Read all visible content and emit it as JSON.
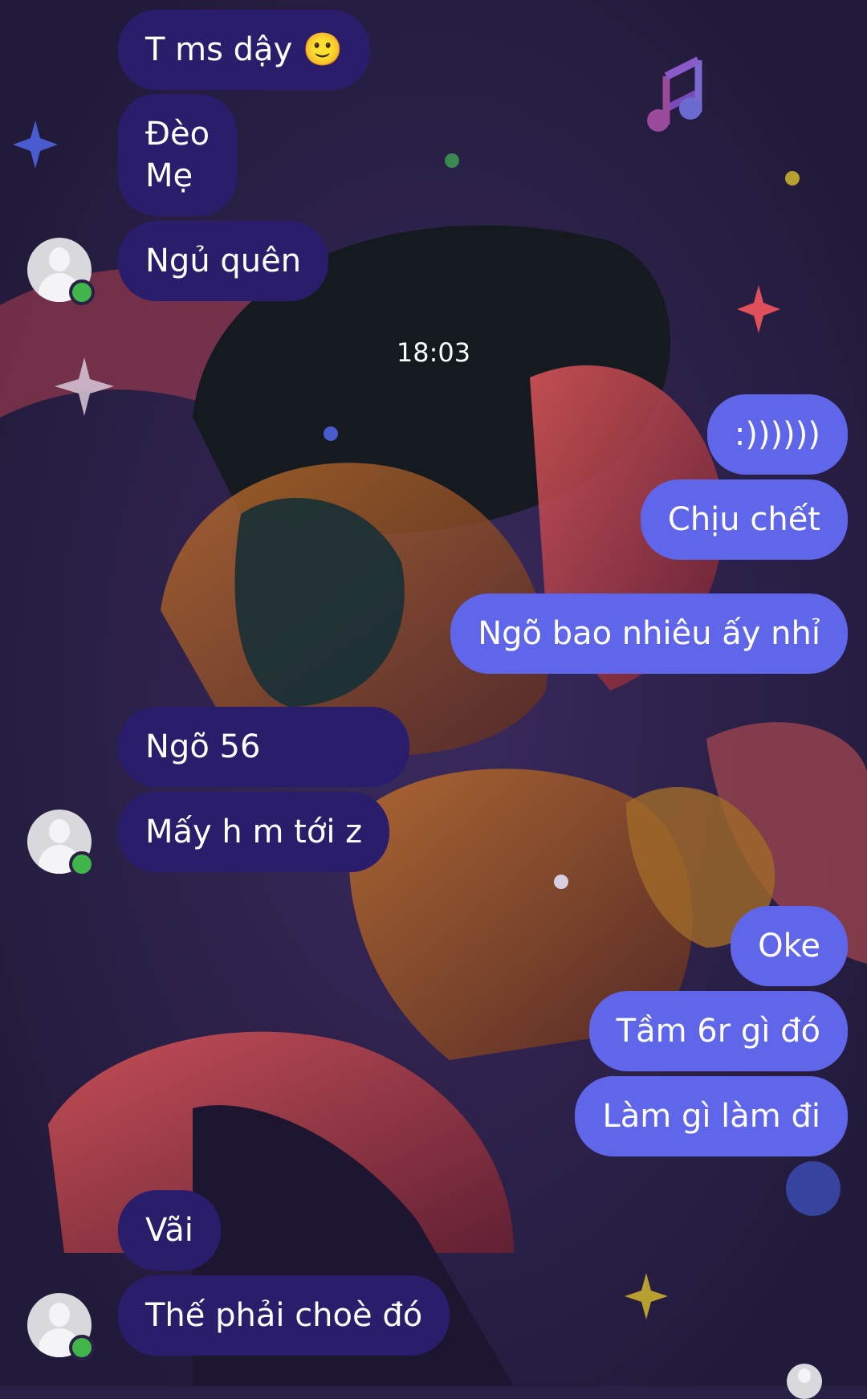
{
  "chat": {
    "timestamp": "18:03",
    "messages": [
      {
        "side": "in",
        "text": "T ms dậy 🙂"
      },
      {
        "side": "in",
        "text": "Đèo\nMẹ"
      },
      {
        "side": "in",
        "text": "Ngủ quên"
      },
      {
        "side": "out",
        "text": ":))))))"
      },
      {
        "side": "out",
        "text": "Chịu chết"
      },
      {
        "side": "out",
        "text": "Ngõ bao nhiêu ấy nhỉ"
      },
      {
        "side": "in",
        "text": "Ngõ 56"
      },
      {
        "side": "in",
        "text": "Mấy h m tới z"
      },
      {
        "side": "out",
        "text": "Oke"
      },
      {
        "side": "out",
        "text": "Tầm 6r gì đó"
      },
      {
        "side": "out",
        "text": "Làm gì làm đi"
      },
      {
        "side": "in",
        "text": "Vãi"
      },
      {
        "side": "in",
        "text": "Thế phải choè đó"
      }
    ]
  },
  "colors": {
    "incoming_bubble": "#2a1d6b",
    "outgoing_bubble": "#6066ea",
    "online_dot": "#3fb54a",
    "background": "#2a1f45"
  },
  "icons": {
    "avatar": "default-user-avatar",
    "status": "online-status-dot"
  }
}
